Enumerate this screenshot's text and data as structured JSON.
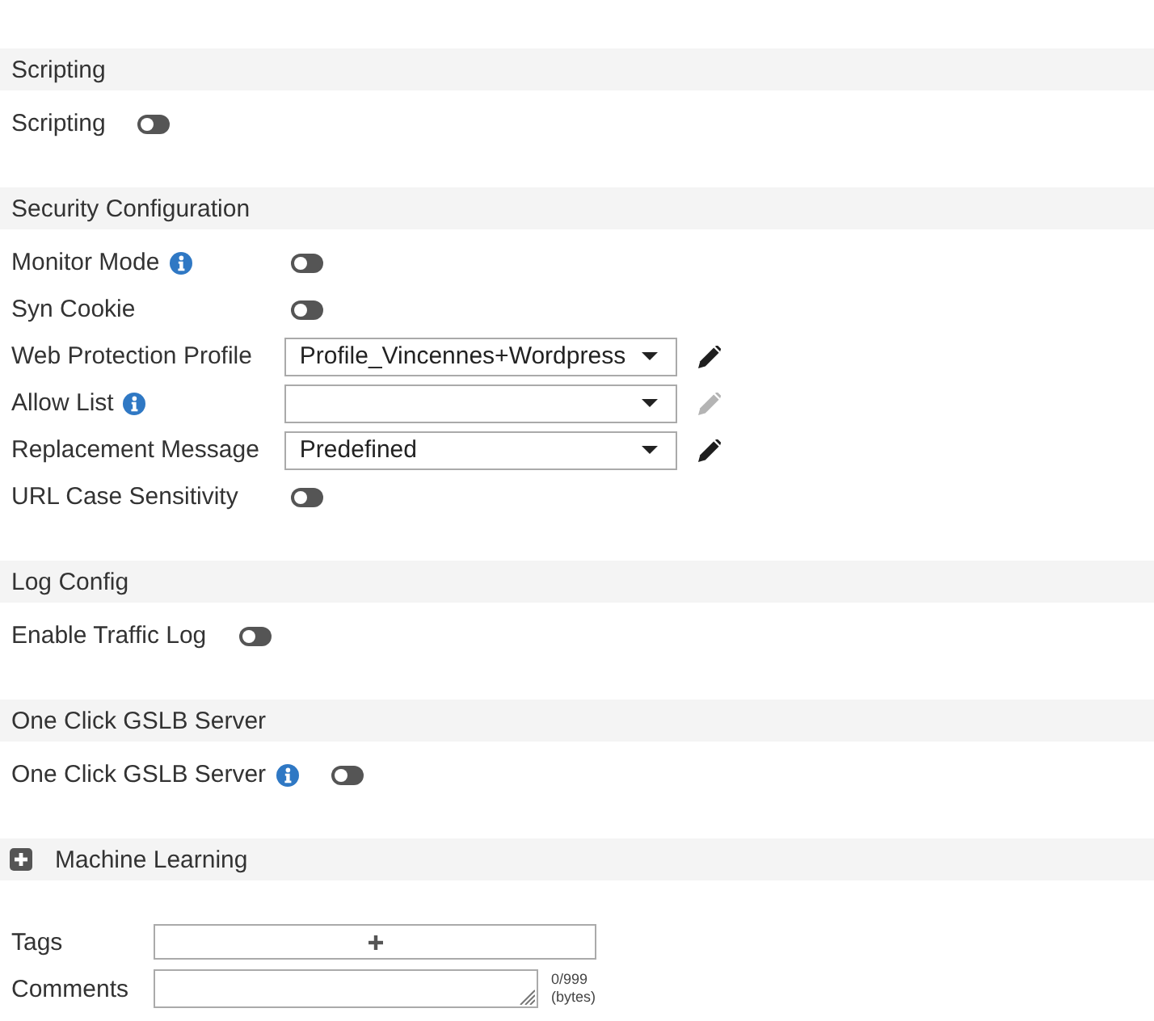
{
  "sections": [
    {
      "kind": "group",
      "title": "Scripting",
      "rows": [
        {
          "kind": "toggle",
          "label": "Scripting",
          "info": false,
          "on": false
        }
      ]
    },
    {
      "kind": "group",
      "title": "Security Configuration",
      "rows": [
        {
          "kind": "toggle",
          "label": "Monitor Mode",
          "info": true,
          "on": false
        },
        {
          "kind": "toggle",
          "label": "Syn Cookie",
          "info": false,
          "on": false
        },
        {
          "kind": "select",
          "label": "Web Protection Profile",
          "info": false,
          "value": "Profile_Vincennes+Wordpress",
          "edit_enabled": true
        },
        {
          "kind": "select",
          "label": "Allow List",
          "info": true,
          "edit_enabled": false
        },
        {
          "kind": "select",
          "label": "Replacement Message",
          "info": false,
          "value": "Predefined",
          "edit_enabled": true
        },
        {
          "kind": "toggle",
          "label": "URL Case Sensitivity",
          "info": false,
          "on": false
        }
      ]
    },
    {
      "kind": "group",
      "title": "Log Config",
      "rows": [
        {
          "kind": "toggle",
          "label": "Enable Traffic Log",
          "info": false,
          "on": false
        }
      ]
    },
    {
      "kind": "group",
      "title": "One Click GSLB Server",
      "rows": [
        {
          "kind": "toggle",
          "label": "One Click GSLB Server",
          "info": true,
          "on": false
        }
      ]
    },
    {
      "kind": "collapsible",
      "title": "Machine Learning",
      "expanded": false
    }
  ],
  "tags": {
    "label": "Tags"
  },
  "comments": {
    "label": "Comments",
    "counter": "0/999",
    "unit": "(bytes)"
  }
}
